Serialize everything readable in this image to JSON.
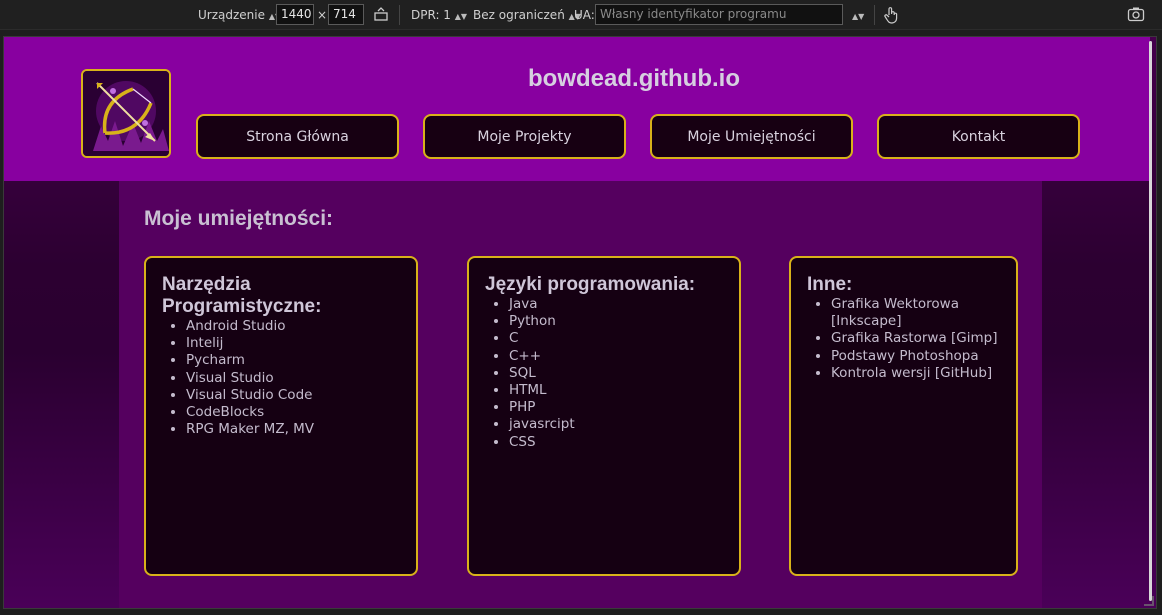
{
  "devtools": {
    "device_label": "Urządzenie",
    "width": "1440",
    "times": "×",
    "height": "714",
    "dpr_label": "DPR: 1",
    "throttle_label": "Bez ograniczeń",
    "ua_label": "UA:",
    "ua_placeholder": "Własny identyfikator programu"
  },
  "site": {
    "title": "bowdead.github.io",
    "nav": [
      {
        "label": "Strona Główna"
      },
      {
        "label": "Moje Projekty"
      },
      {
        "label": "Moje Umiejętności"
      },
      {
        "label": "Kontakt"
      }
    ]
  },
  "skills": {
    "heading": "Moje umiejętności:",
    "cards": [
      {
        "title": "Narzędzia Programistyczne:",
        "items": [
          "Android Studio",
          "Intelij",
          "Pycharm",
          "Visual Studio",
          "Visual Studio Code",
          "CodeBlocks",
          "RPG Maker MZ, MV"
        ]
      },
      {
        "title": "Języki programowania:",
        "items": [
          "Java",
          "Python",
          "C",
          "C++",
          "SQL",
          "HTML",
          "PHP",
          "javasrcipt",
          "CSS"
        ]
      },
      {
        "title": "Inne:",
        "items": [
          "Grafika Wektorowa [Inkscape]",
          "Grafika Rastorwa [Gimp]",
          "Podstawy Photoshopa",
          "Kontrola wersji [GitHub]"
        ]
      }
    ]
  },
  "colors": {
    "header_bg": "#8800a0",
    "content_bg": "#55005f",
    "card_bg": "#150012",
    "accent_border": "#d8b21a",
    "text": "#c9c0d2"
  }
}
